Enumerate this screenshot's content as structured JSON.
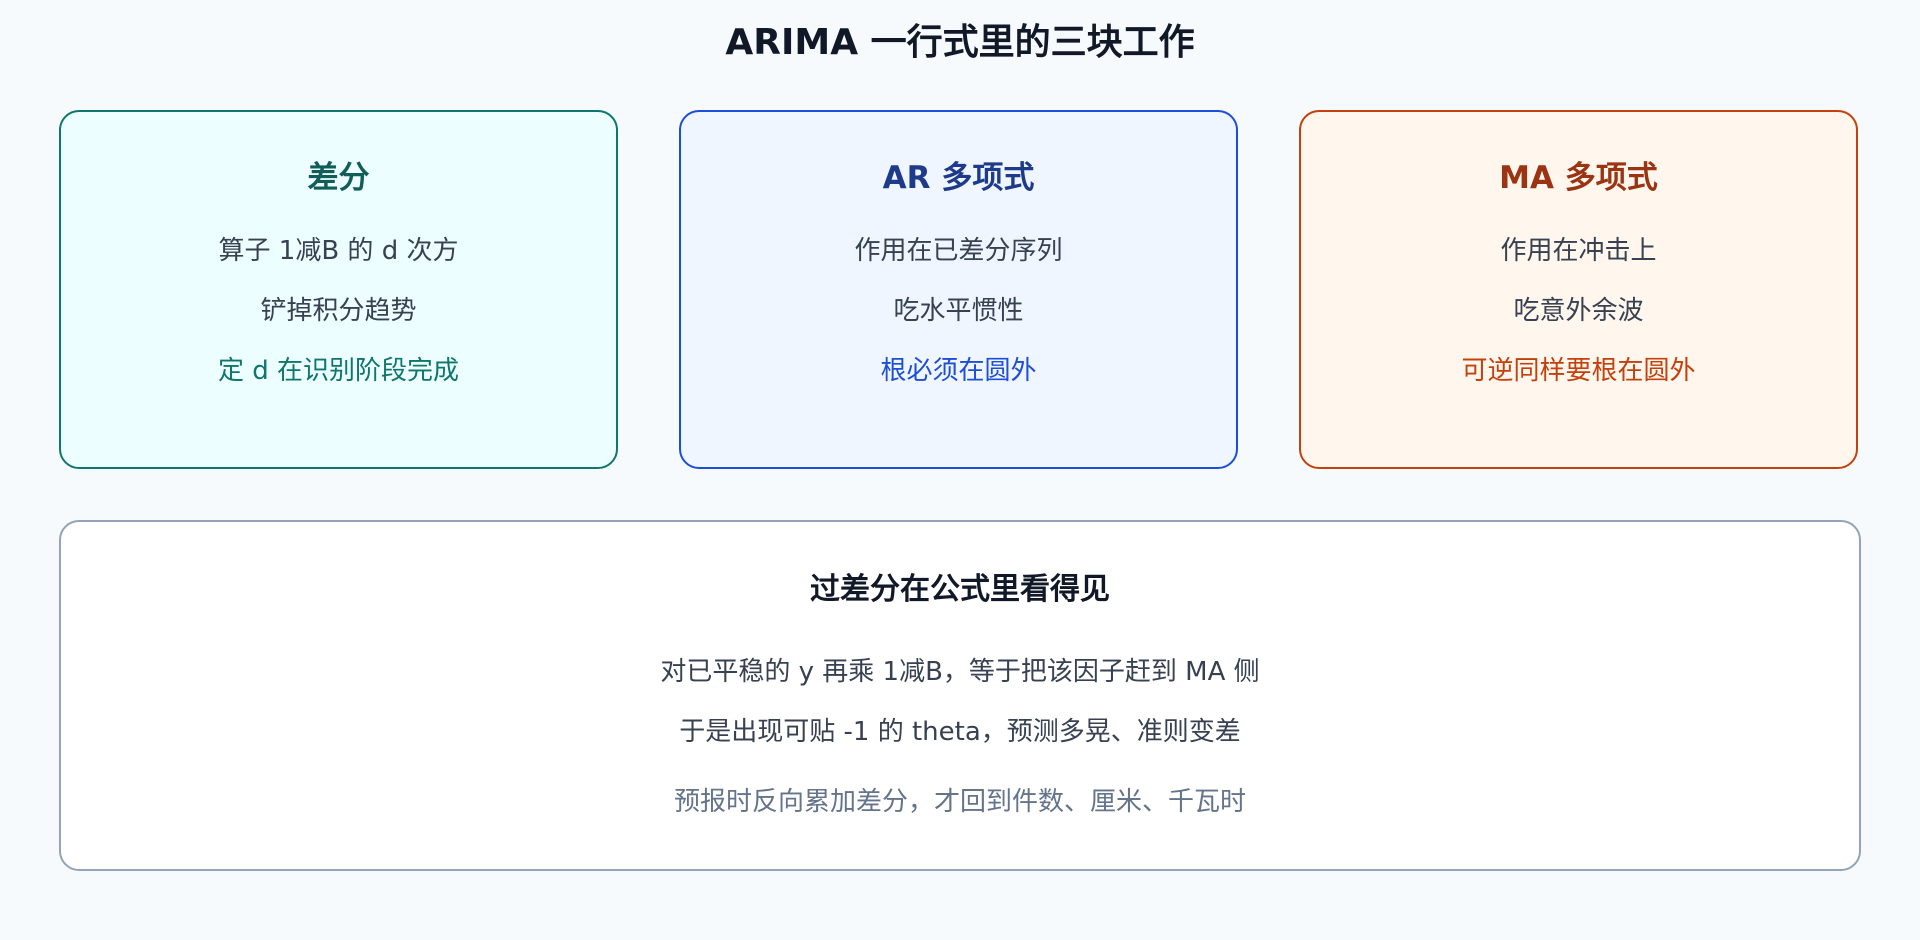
{
  "title": "ARIMA 一行式里的三块工作",
  "cards": [
    {
      "heading": "差分",
      "lines": [
        "算子 1减B 的 d 次方",
        "铲掉积分趋势"
      ],
      "accent": "定 d 在识别阶段完成",
      "colors": {
        "border": "#0f766e",
        "background": "#ecfeff",
        "heading": "#115e59",
        "accent": "#0f766e"
      }
    },
    {
      "heading": "AR 多项式",
      "lines": [
        "作用在已差分序列",
        "吃水平惯性"
      ],
      "accent": "根必须在圆外",
      "colors": {
        "border": "#1d4ed8",
        "background": "#eff6ff",
        "heading": "#1e3a8a",
        "accent": "#1d4ed8"
      }
    },
    {
      "heading": "MA 多项式",
      "lines": [
        "作用在冲击上",
        "吃意外余波"
      ],
      "accent": "可逆同样要根在圆外",
      "colors": {
        "border": "#c2410c",
        "background": "#fff7ed",
        "heading": "#9a3412",
        "accent": "#c2410c"
      }
    }
  ],
  "bottom": {
    "heading": "过差分在公式里看得见",
    "lines": [
      "对已平稳的 y 再乘 1减B，等于把该因子赶到 MA 侧",
      "于是出现可贴 -1 的 theta，预测多晃、准则变差"
    ],
    "note": "预报时反向累加差分，才回到件数、厘米、千瓦时"
  }
}
